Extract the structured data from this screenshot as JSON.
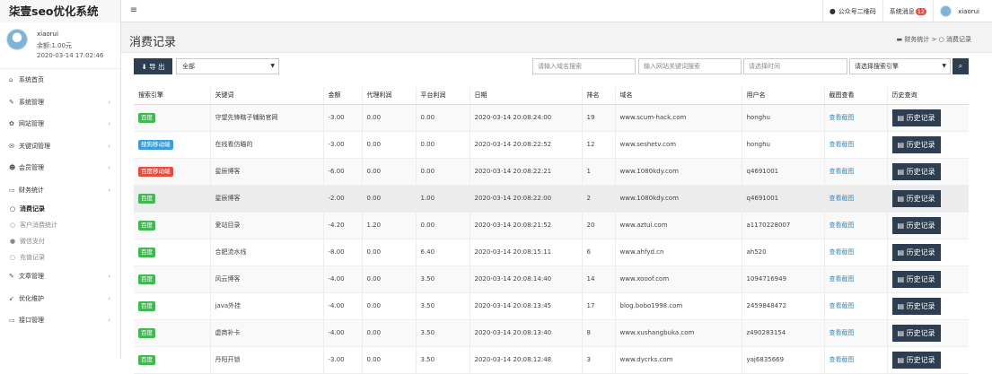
{
  "app": {
    "title": "柒壹seo优化系统"
  },
  "header": {
    "qr_label": "公众号二维码",
    "msg_label": "系统消息",
    "msg_count": "12",
    "username": "xiaorui"
  },
  "user": {
    "name": "xiaorui",
    "balance": "余额:1.00元",
    "login_time": "2020-03-14 17:02:46"
  },
  "sidebar": {
    "items": [
      {
        "label": "系统首页",
        "icon": "home-icon",
        "chev": false
      },
      {
        "label": "系统管理",
        "icon": "wrench-icon",
        "chev": true
      },
      {
        "label": "网站管理",
        "icon": "gear-icon",
        "chev": true
      },
      {
        "label": "关键词管理",
        "icon": "comment-icon",
        "chev": true
      },
      {
        "label": "会员管理",
        "icon": "users-icon",
        "chev": true
      },
      {
        "label": "财务统计",
        "icon": "card-icon",
        "chev": true
      }
    ],
    "subitems": [
      {
        "label": "消费记录",
        "icon": "circle-icon",
        "active": true
      },
      {
        "label": "客户消费统计",
        "icon": "circle-icon",
        "active": false
      },
      {
        "label": "微信支付",
        "icon": "wechat-icon",
        "active": false
      },
      {
        "label": "充值记录",
        "icon": "circle-icon",
        "active": false
      }
    ],
    "items2": [
      {
        "label": "文章管理",
        "icon": "edit-icon",
        "chev": true
      },
      {
        "label": "优化维护",
        "icon": "rocket-icon",
        "chev": true
      },
      {
        "label": "接口管理",
        "icon": "card-icon",
        "chev": true
      }
    ]
  },
  "page": {
    "title": "消费记录",
    "breadcrumb": {
      "parent": "财务统计",
      "sep": ">",
      "current": "消费记录"
    }
  },
  "toolbar": {
    "export_label": "导 出",
    "select_value": "全部",
    "domain_placeholder": "请输入域名搜索",
    "keyword_placeholder": "输入网站关键词搜索",
    "time_placeholder": "请选择时间",
    "engine_placeholder": "请选择搜索引擎"
  },
  "table": {
    "headers": [
      "搜索引擎",
      "关键词",
      "金额",
      "代理利润",
      "平台利润",
      "日期",
      "排名",
      "域名",
      "用户名",
      "截图查看",
      "历史查询"
    ],
    "view_label": "查看截图",
    "history_label": "历史记录",
    "rows": [
      {
        "engine": "百度",
        "engine_color": "#3fb950",
        "keyword": "守望先锋瞎子辅助官网",
        "amount": "-3.00",
        "agent": "0.00",
        "platform": "0.00",
        "date": "2020-03-14 20:08:24:00",
        "rank": "19",
        "domain": "www.scum-hack.com",
        "user": "honghu"
      },
      {
        "engine": "搜狗移动端",
        "engine_color": "#3a9fd8",
        "keyword": "在线看仿瞄的",
        "amount": "-3.00",
        "agent": "0.00",
        "platform": "0.00",
        "date": "2020-03-14 20:08:22:52",
        "rank": "12",
        "domain": "www.seshetv.com",
        "user": "honghu"
      },
      {
        "engine": "百度移动端",
        "engine_color": "#e74c3c",
        "keyword": "星辰博客",
        "amount": "-6.00",
        "agent": "0.00",
        "platform": "0.00",
        "date": "2020-03-14 20:08:22:21",
        "rank": "1",
        "domain": "www.1080kdy.com",
        "user": "q4691001"
      },
      {
        "engine": "百度",
        "engine_color": "#3fb950",
        "keyword": "星辰博客",
        "amount": "-2.00",
        "agent": "0.00",
        "platform": "1.00",
        "date": "2020-03-14 20:08:22:00",
        "rank": "2",
        "domain": "www.1080kdy.com",
        "user": "q4691001"
      },
      {
        "engine": "百度",
        "engine_color": "#3fb950",
        "keyword": "爱站目录",
        "amount": "-4.20",
        "agent": "1.20",
        "platform": "0.00",
        "date": "2020-03-14 20:08:21:52",
        "rank": "20",
        "domain": "www.aztui.com",
        "user": "a1170228007"
      },
      {
        "engine": "百度",
        "engine_color": "#3fb950",
        "keyword": "合肥流水线",
        "amount": "-8.00",
        "agent": "0.00",
        "platform": "6.40",
        "date": "2020-03-14 20:08:15:11",
        "rank": "6",
        "domain": "www.ahfyd.cn",
        "user": "ah520"
      },
      {
        "engine": "百度",
        "engine_color": "#3fb950",
        "keyword": "风云博客",
        "amount": "-4.00",
        "agent": "0.00",
        "platform": "3.50",
        "date": "2020-03-14 20:08:14:40",
        "rank": "14",
        "domain": "www.xooof.com",
        "user": "1094716949"
      },
      {
        "engine": "百度",
        "engine_color": "#3fb950",
        "keyword": "java外挂",
        "amount": "-4.00",
        "agent": "0.00",
        "platform": "3.50",
        "date": "2020-03-14 20:08:13:45",
        "rank": "17",
        "domain": "blog.bobo1998.com",
        "user": "2459848472"
      },
      {
        "engine": "百度",
        "engine_color": "#3fb950",
        "keyword": "虚商补卡",
        "amount": "-4.00",
        "agent": "0.00",
        "platform": "3.50",
        "date": "2020-03-14 20:08:13:40",
        "rank": "8",
        "domain": "www.xushangbuka.com",
        "user": "z490283154"
      },
      {
        "engine": "百度",
        "engine_color": "#3fb950",
        "keyword": "丹阳开锁",
        "amount": "-3.00",
        "agent": "0.00",
        "platform": "3.50",
        "date": "2020-03-14 20:08:12:48",
        "rank": "3",
        "domain": "www.dycrks.com",
        "user": "yaj6835669"
      }
    ]
  }
}
